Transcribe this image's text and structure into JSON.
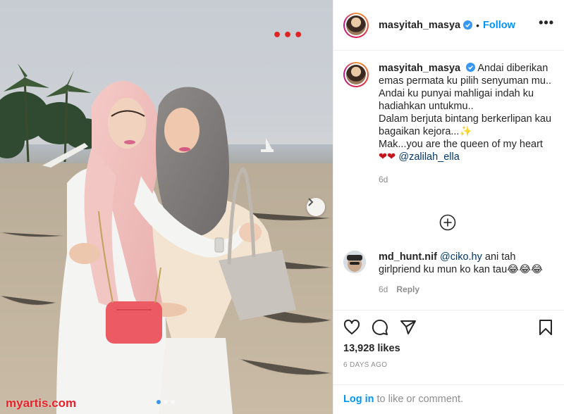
{
  "post": {
    "username": "masyitah_masya",
    "follow_label": "Follow",
    "separator": "•",
    "more_label": "•••"
  },
  "photo": {
    "overlay_dots": "•••",
    "watermark": "myartis.com",
    "carousel_count": 3,
    "carousel_active": 0
  },
  "caption": {
    "username": "masyitah_masya",
    "lines": [
      "Andai diberikan emas permata ku pilih senyuman mu..",
      "Andai ku punyai mahligai indah ku hadiahkan untukmu..",
      "Dalam berjuta bintang berkerlipan kau bagaikan kejora...✨",
      "Mak...you are the queen of my heart"
    ],
    "hearts": "❤❤",
    "mention": "@zalilah_ella",
    "time": "6d"
  },
  "comment": {
    "username": "md_hunt.nif",
    "mention": "@ciko.hy",
    "text": " ani tah girlpriend ku mun ko kan tau😂😂😂",
    "time": "6d",
    "reply_label": "Reply"
  },
  "actions": {
    "likes": "13,928 likes",
    "days_ago": "6 DAYS AGO",
    "login_link": "Log in",
    "login_rest": " to like or comment."
  },
  "icons": [
    "heart-icon",
    "comment-icon",
    "share-icon",
    "bookmark-icon",
    "plus-circle-icon",
    "chevron-right-icon",
    "verified-badge-icon"
  ],
  "colors": {
    "follow": "#0095f6",
    "watermark": "#e8202a",
    "verified": "#3897f0"
  }
}
